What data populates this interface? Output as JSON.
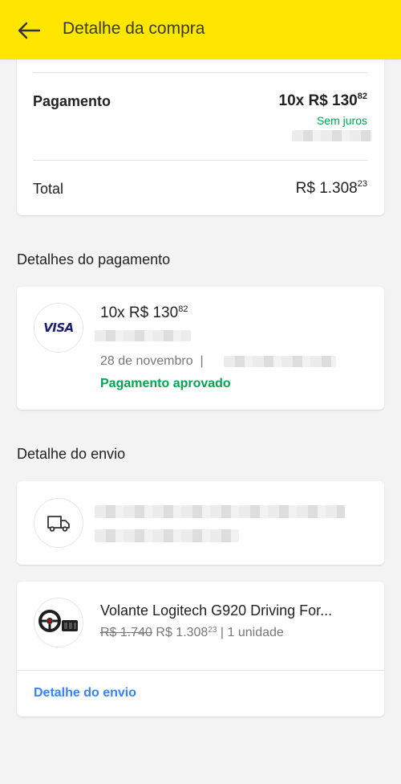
{
  "header": {
    "title": "Detalhe da compra"
  },
  "summary": {
    "payment_label": "Pagamento",
    "payment_amount_main": "10x R$ 130",
    "payment_amount_cents": "82",
    "payment_note": "Sem juros",
    "total_label": "Total",
    "total_main": "R$ 1.308",
    "total_cents": "23"
  },
  "payment_details": {
    "section_title": "Detalhes do pagamento",
    "card_brand": "VISA",
    "amount_main": "10x R$ 130",
    "amount_cents": "82",
    "date": "28 de novembro",
    "date_separator": "|",
    "status": "Pagamento aprovado",
    "status_color": "#00a650"
  },
  "shipping": {
    "section_title": "Detalhe do envio",
    "icon": "truck-icon"
  },
  "product": {
    "title": "Volante Logitech G920 Driving For...",
    "old_price": "R$ 1.740",
    "price_main": "R$ 1.308",
    "price_cents": "23",
    "quantity": "| 1 unidade",
    "link_label": "Detalhe do envio"
  },
  "colors": {
    "accent": "#ffe600",
    "link": "#3483fa",
    "success": "#00a650"
  }
}
